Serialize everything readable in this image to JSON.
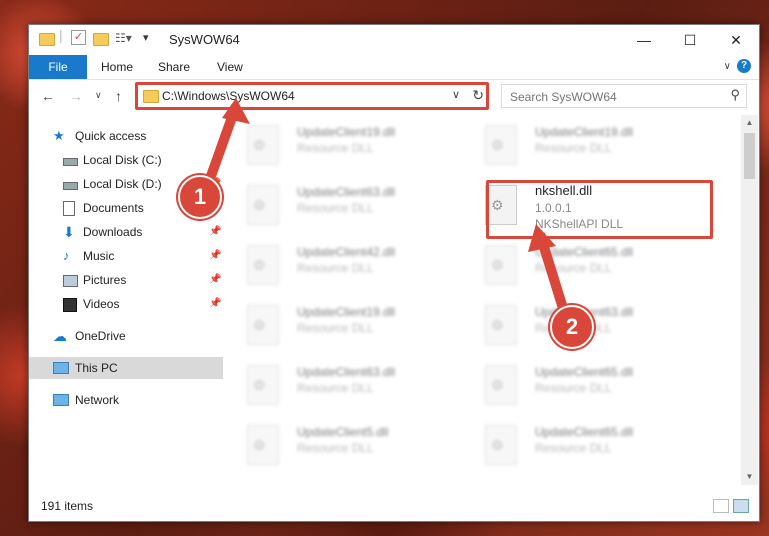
{
  "window": {
    "title": "SysWOW64"
  },
  "ribbon": {
    "file": "File",
    "home": "Home",
    "share": "Share",
    "view": "View",
    "help": "?"
  },
  "address": {
    "path": "C:\\Windows\\SysWOW64"
  },
  "search": {
    "placeholder": "Search SysWOW64"
  },
  "sidebar": {
    "items": [
      {
        "label": "Quick access",
        "icon": "star-icon"
      },
      {
        "label": "Local Disk (C:)",
        "icon": "drive-icon"
      },
      {
        "label": "Local Disk (D:)",
        "icon": "drive-icon"
      },
      {
        "label": "Documents",
        "icon": "documents-icon"
      },
      {
        "label": "Downloads",
        "icon": "download-icon"
      },
      {
        "label": "Music",
        "icon": "music-icon"
      },
      {
        "label": "Pictures",
        "icon": "pictures-icon"
      },
      {
        "label": "Videos",
        "icon": "videos-icon"
      },
      {
        "label": "OneDrive",
        "icon": "cloud-icon"
      },
      {
        "label": "This PC",
        "icon": "computer-icon"
      },
      {
        "label": "Network",
        "icon": "network-icon"
      }
    ]
  },
  "files": {
    "left": [
      {
        "name": "UpdateClient19.dll",
        "desc": "Resource DLL"
      },
      {
        "name": "UpdateClient63.dll",
        "desc": "Resource DLL"
      },
      {
        "name": "UpdateClient42.dll",
        "desc": "Resource DLL"
      },
      {
        "name": "UpdateClient19.dll",
        "desc": "Resource DLL"
      },
      {
        "name": "UpdateClient63.dll",
        "desc": "Resource DLL"
      },
      {
        "name": "UpdateClient5.dll",
        "desc": "Resource DLL"
      }
    ],
    "right": [
      {
        "name": "UpdateClient19.dll",
        "desc": "Resource DLL"
      },
      {
        "name": "UpdateClient65.dll",
        "desc": "Resource DLL"
      },
      {
        "name": "UpdateClient63.dll",
        "desc": "Resource DLL"
      },
      {
        "name": "UpdateClient65.dll",
        "desc": "Resource DLL"
      },
      {
        "name": "UpdateClient65.dll",
        "desc": "Resource DLL"
      }
    ],
    "highlight": {
      "name": "nkshell.dll",
      "version": "1.0.0.1",
      "desc": "NKShellAPI DLL"
    }
  },
  "status": {
    "count": "191 items"
  },
  "callouts": {
    "one": "1",
    "two": "2"
  },
  "colors": {
    "accent": "#1979ca",
    "callout": "#d9463a"
  }
}
